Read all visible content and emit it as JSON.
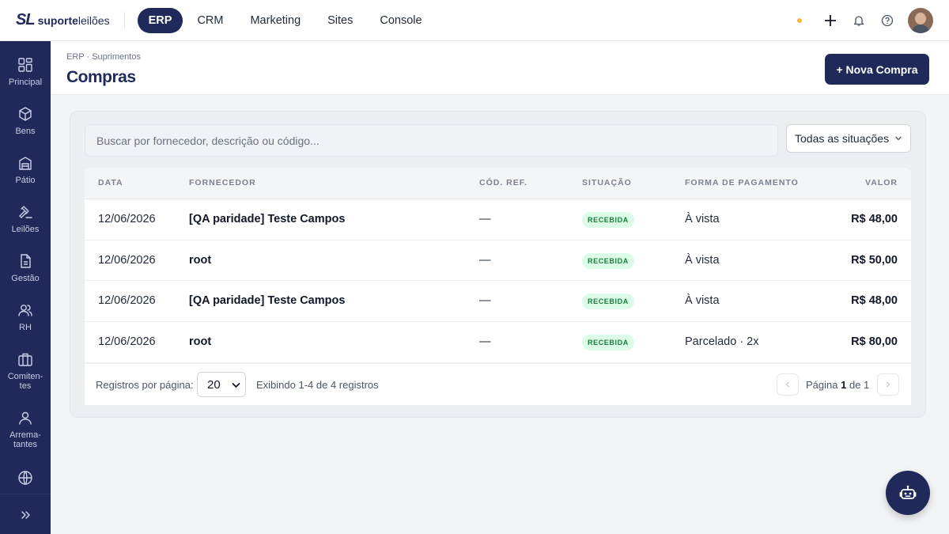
{
  "brand": {
    "mark": "SL",
    "name_bold": "suporte",
    "name_light": "leilões"
  },
  "topnav": [
    {
      "label": "ERP",
      "active": true
    },
    {
      "label": "CRM",
      "active": false
    },
    {
      "label": "Marketing",
      "active": false
    },
    {
      "label": "Sites",
      "active": false
    },
    {
      "label": "Console",
      "active": false
    }
  ],
  "sidebar": {
    "items": [
      {
        "label": "Principal",
        "icon": "grid-icon"
      },
      {
        "label": "Bens",
        "icon": "box-icon"
      },
      {
        "label": "Pátio",
        "icon": "warehouse-icon"
      },
      {
        "label": "Leilões",
        "icon": "gavel-icon"
      },
      {
        "label": "Gestão",
        "icon": "document-icon"
      },
      {
        "label": "RH",
        "icon": "users-icon"
      },
      {
        "label": "Comiten-\ntes",
        "icon": "briefcase-icon"
      },
      {
        "label": "Arrema-\ntantes",
        "icon": "user-icon"
      },
      {
        "label": "",
        "icon": "globe-icon"
      }
    ]
  },
  "header": {
    "breadcrumb": "ERP · Suprimentos",
    "title": "Compras",
    "new_button": "+ Nova Compra"
  },
  "filters": {
    "search_placeholder": "Buscar por fornecedor, descrição ou código...",
    "status_select": "Todas as situações"
  },
  "table": {
    "columns": [
      "DATA",
      "FORNECEDOR",
      "CÓD. REF.",
      "SITUAÇÃO",
      "FORMA DE PAGAMENTO",
      "VALOR"
    ],
    "rows": [
      {
        "date": "12/06/2026",
        "supplier": "[QA paridade] Teste Campos",
        "ref": "—",
        "status": "RECEBIDA",
        "payment": "À vista",
        "value": "R$ 48,00"
      },
      {
        "date": "12/06/2026",
        "supplier": "root",
        "ref": "—",
        "status": "RECEBIDA",
        "payment": "À vista",
        "value": "R$ 50,00"
      },
      {
        "date": "12/06/2026",
        "supplier": "[QA paridade] Teste Campos",
        "ref": "—",
        "status": "RECEBIDA",
        "payment": "À vista",
        "value": "R$ 48,00"
      },
      {
        "date": "12/06/2026",
        "supplier": "root",
        "ref": "—",
        "status": "RECEBIDA",
        "payment": "Parcelado · 2x",
        "value": "R$ 80,00"
      }
    ]
  },
  "pagination": {
    "per_page_label": "Registros por página:",
    "per_page_value": "20",
    "info": "Exibindo 1-4 de 4 registros",
    "page_prefix": "Página",
    "page_current": "1",
    "page_of": "de 1"
  },
  "colors": {
    "brand_navy": "#1f2a5a",
    "status_green": "#15803d",
    "status_bg": "#dcfce7",
    "notification_dot": "#f5b942"
  }
}
